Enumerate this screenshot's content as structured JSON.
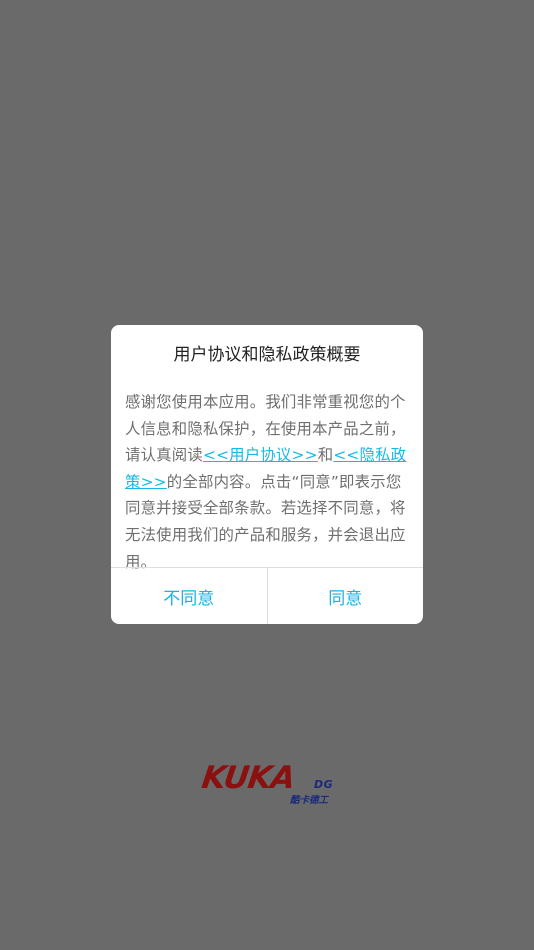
{
  "dialog": {
    "title": "用户协议和隐私政策概要",
    "body": {
      "text_before": "感谢您使用本应用。我们非常重视您的个人信息和隐私保护，在使用本产品之前，请认真阅读",
      "link_user_agreement": "<<用户协议>>",
      "text_and": "和",
      "link_privacy_policy": "<<隐私政策>>",
      "text_after": "的全部内容。点击“同意”即表示您同意并接受全部条款。若选择不同意，将无法使用我们的产品和服务，并会退出应用。"
    },
    "buttons": {
      "disagree": "不同意",
      "agree": "同意"
    }
  },
  "logo": {
    "main": "KUKA",
    "suffix": "DG",
    "chinese": "酷卡德工"
  },
  "colors": {
    "overlay": "#6a6a6a",
    "accent": "#19b2e6",
    "logo_red": "#8b1010",
    "logo_blue": "#1a2a7a"
  }
}
